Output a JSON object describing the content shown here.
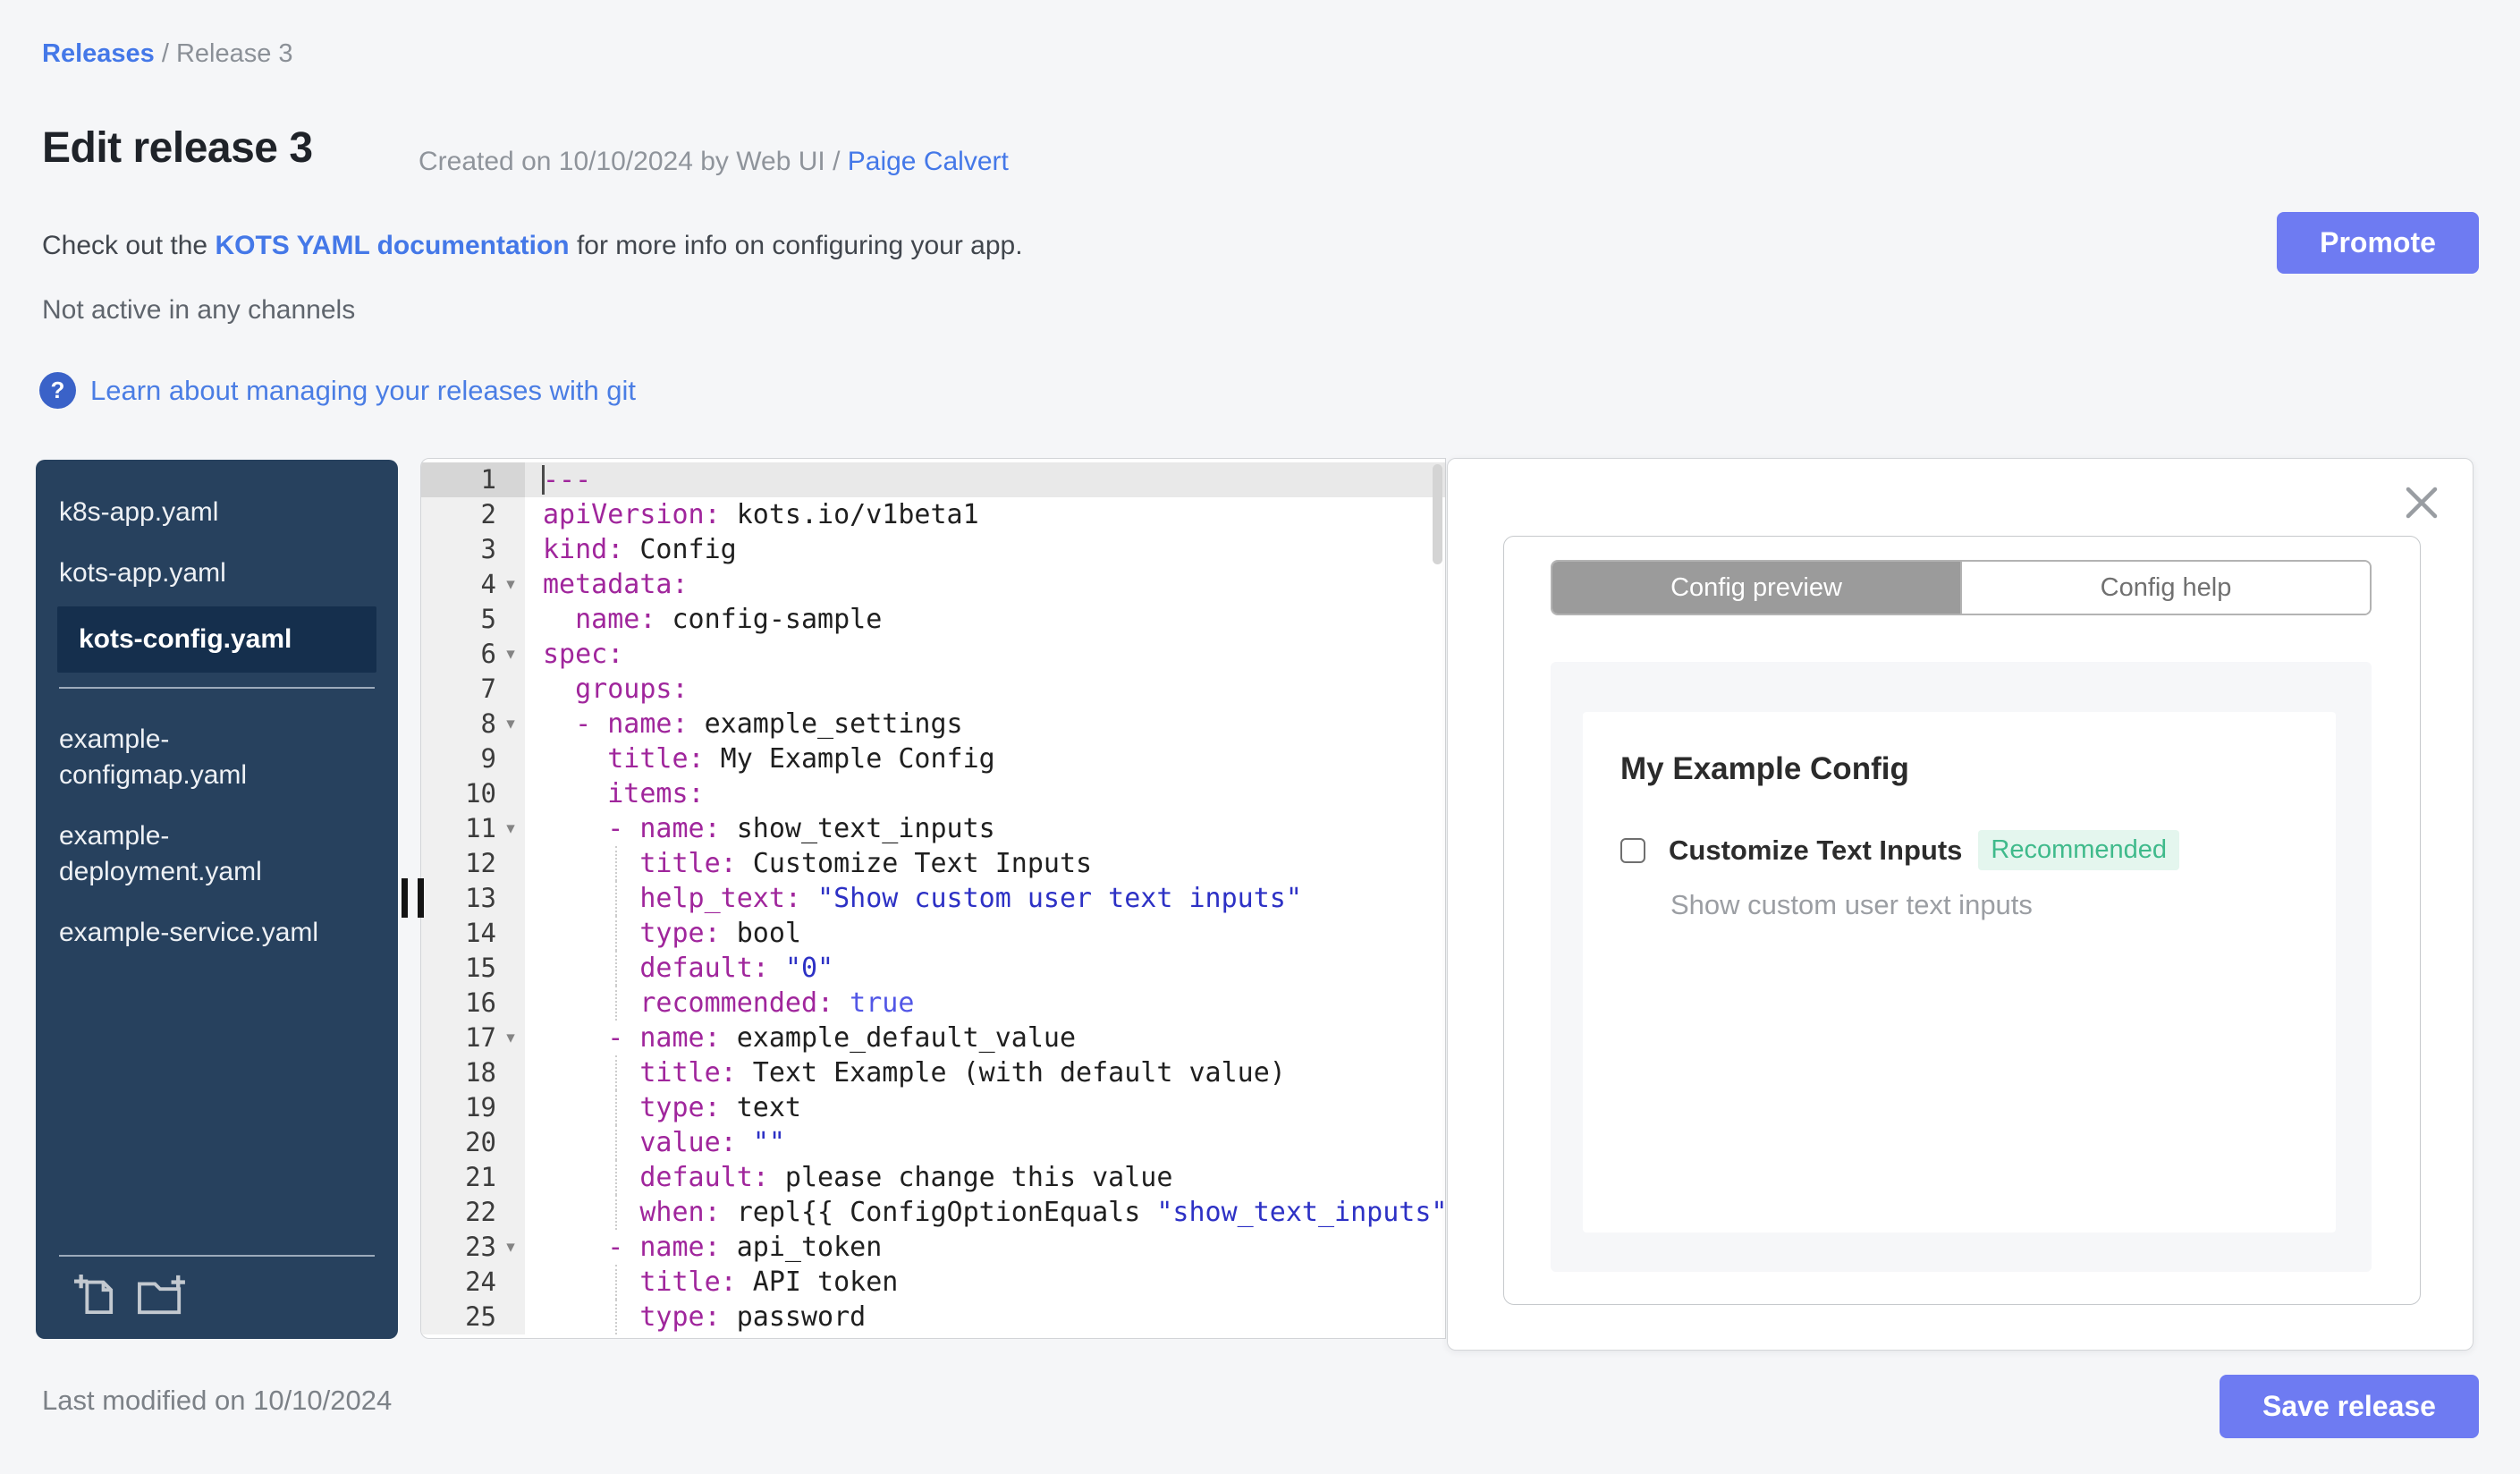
{
  "breadcrumb": {
    "releases_link": "Releases",
    "separator": " / ",
    "current": "Release 3"
  },
  "header": {
    "title": "Edit release 3",
    "created_prefix": "Created on 10/10/2024 by Web UI / ",
    "created_author": "Paige Calvert",
    "doc_prefix": "Check out the ",
    "doc_link": "KOTS YAML documentation",
    "doc_suffix": " for more info on configuring your app.",
    "channel_status": "Not active in any channels",
    "git_help_icon": "?",
    "git_link": "Learn about managing your releases with git",
    "promote_label": "Promote"
  },
  "sidebar": {
    "groups": [
      {
        "files": [
          "k8s-app.yaml",
          "kots-app.yaml",
          "kots-config.yaml"
        ]
      },
      {
        "files": [
          "example-configmap.yaml",
          "example-deployment.yaml",
          "example-service.yaml"
        ]
      }
    ],
    "selected_file": "kots-config.yaml"
  },
  "editor": {
    "fold_glyph": "▾",
    "lines": [
      {
        "n": 1,
        "active": true,
        "seg": [
          [
            "doc",
            "---"
          ]
        ]
      },
      {
        "n": 2,
        "seg": [
          [
            "k",
            "apiVersion:"
          ],
          [
            "v",
            " kots.io/v1beta1"
          ]
        ]
      },
      {
        "n": 3,
        "seg": [
          [
            "k",
            "kind:"
          ],
          [
            "v",
            " Config"
          ]
        ]
      },
      {
        "n": 4,
        "fold": true,
        "seg": [
          [
            "k",
            "metadata:"
          ]
        ]
      },
      {
        "n": 5,
        "seg": [
          [
            "k",
            "  name:"
          ],
          [
            "v",
            " config-sample"
          ]
        ]
      },
      {
        "n": 6,
        "fold": true,
        "seg": [
          [
            "k",
            "spec:"
          ]
        ]
      },
      {
        "n": 7,
        "seg": [
          [
            "k",
            "  groups:"
          ]
        ]
      },
      {
        "n": 8,
        "fold": true,
        "seg": [
          [
            "k",
            "  - name:"
          ],
          [
            "v",
            " example_settings"
          ]
        ]
      },
      {
        "n": 9,
        "seg": [
          [
            "k",
            "    title:"
          ],
          [
            "v",
            " My Example Config"
          ]
        ]
      },
      {
        "n": 10,
        "seg": [
          [
            "k",
            "    items:"
          ]
        ]
      },
      {
        "n": 11,
        "fold": true,
        "seg": [
          [
            "k",
            "    - name:"
          ],
          [
            "v",
            " show_text_inputs"
          ]
        ]
      },
      {
        "n": 12,
        "guide": true,
        "seg": [
          [
            "k",
            "      title:"
          ],
          [
            "v",
            " Customize Text Inputs"
          ]
        ]
      },
      {
        "n": 13,
        "guide": true,
        "seg": [
          [
            "k",
            "      help_text:"
          ],
          [
            "v",
            " "
          ],
          [
            "s",
            "\"Show custom user text inputs\""
          ]
        ]
      },
      {
        "n": 14,
        "guide": true,
        "seg": [
          [
            "k",
            "      type:"
          ],
          [
            "v",
            " bool"
          ]
        ]
      },
      {
        "n": 15,
        "guide": true,
        "seg": [
          [
            "k",
            "      default:"
          ],
          [
            "v",
            " "
          ],
          [
            "s",
            "\"0\""
          ]
        ]
      },
      {
        "n": 16,
        "guide": true,
        "seg": [
          [
            "k",
            "      recommended:"
          ],
          [
            "v",
            " "
          ],
          [
            "b",
            "true"
          ]
        ]
      },
      {
        "n": 17,
        "fold": true,
        "seg": [
          [
            "k",
            "    - name:"
          ],
          [
            "v",
            " example_default_value"
          ]
        ]
      },
      {
        "n": 18,
        "guide": true,
        "seg": [
          [
            "k",
            "      title:"
          ],
          [
            "v",
            " Text Example (with default value)"
          ]
        ]
      },
      {
        "n": 19,
        "guide": true,
        "seg": [
          [
            "k",
            "      type:"
          ],
          [
            "v",
            " text"
          ]
        ]
      },
      {
        "n": 20,
        "guide": true,
        "seg": [
          [
            "k",
            "      value:"
          ],
          [
            "v",
            " "
          ],
          [
            "s",
            "\"\""
          ]
        ]
      },
      {
        "n": 21,
        "guide": true,
        "seg": [
          [
            "k",
            "      default:"
          ],
          [
            "v",
            " please change this value"
          ]
        ]
      },
      {
        "n": 22,
        "guide": true,
        "seg": [
          [
            "k",
            "      when:"
          ],
          [
            "v",
            " repl{{ ConfigOptionEquals "
          ],
          [
            "s",
            "\"show_text_inputs\""
          ]
        ]
      },
      {
        "n": 23,
        "fold": true,
        "seg": [
          [
            "k",
            "    - name:"
          ],
          [
            "v",
            " api_token"
          ]
        ]
      },
      {
        "n": 24,
        "guide": true,
        "seg": [
          [
            "k",
            "      title:"
          ],
          [
            "v",
            " API token"
          ]
        ]
      },
      {
        "n": 25,
        "guide": true,
        "seg": [
          [
            "k",
            "      type:"
          ],
          [
            "v",
            " password"
          ]
        ]
      }
    ]
  },
  "panel": {
    "tabs": [
      {
        "label": "Config preview",
        "active": true
      },
      {
        "label": "Config help",
        "active": false
      }
    ],
    "group_title": "My Example Config",
    "item": {
      "label": "Customize Text Inputs",
      "badge": "Recommended",
      "help_text": "Show custom user text inputs",
      "checked": false
    }
  },
  "footer": {
    "last_modified": "Last modified on 10/10/2024",
    "save_label": "Save release"
  },
  "colors": {
    "accent_button": "#6e7bf2",
    "link_blue": "#4478e8",
    "sidebar_bg": "#27415e",
    "sidebar_selected_bg": "#152f4d",
    "yaml_key": "#a0269c",
    "yaml_string": "#2d31c5",
    "badge_green": "#3fba8b",
    "badge_green_bg": "#e4f6ee",
    "tab_active_bg": "#9b9b9b"
  }
}
